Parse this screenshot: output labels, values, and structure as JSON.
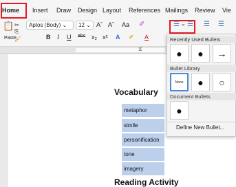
{
  "tabs": [
    "Home",
    "Insert",
    "Draw",
    "Design",
    "Layout",
    "References",
    "Mailings",
    "Review",
    "Vie"
  ],
  "toolbar": {
    "paste_label": "Paste",
    "font_name": "Aptos (Body)",
    "font_size": "12",
    "grow_font": "Aˆ",
    "shrink_font": "Aˇ",
    "change_case": "Aa",
    "bold": "B",
    "italic": "I",
    "underline": "U",
    "strikethrough": "abc",
    "subscript": "x₂",
    "superscript": "x²",
    "text_effects": "A",
    "highlight": "✐",
    "font_color": "A"
  },
  "colors": {
    "highlight_box": "#e11b22",
    "selection": "#bcd0ec",
    "selected_bullet_border": "#4a8bd6"
  },
  "document": {
    "heading": "Vocabulary",
    "list": [
      "metaphor",
      "simile",
      "personification",
      "tone",
      "imagery"
    ],
    "next_heading": "Reading Activity"
  },
  "bullet_menu": {
    "recent_title": "Recently Used Bullets",
    "recent": [
      "●",
      "●",
      "→"
    ],
    "library_title": "Bullet Library",
    "library": [
      "None",
      "●",
      "○"
    ],
    "document_title": "Document Bullets",
    "document": [
      "●"
    ],
    "define_new": "Define New Bullet..."
  }
}
